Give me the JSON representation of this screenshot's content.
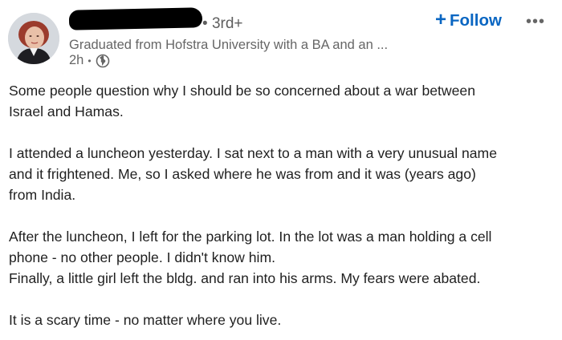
{
  "author": {
    "degree": "3rd+",
    "headline": "Graduated from Hofstra University with a BA and an ...",
    "time": "2h"
  },
  "follow": {
    "plus": "+",
    "label": "Follow"
  },
  "more_label": "•••",
  "post": {
    "paragraphs": [
      "Some people question why I should be so concerned about a war between\nIsrael and Hamas.",
      "I attended a luncheon yesterday. I sat next to a man with a very unusual name\nand it frightened. Me, so I asked where he was from and it was (years ago)\nfrom India.",
      "After the luncheon, I left for the parking lot. In the lot was a man holding a cell\nphone - no other people. I didn't know him.\nFinally, a little girl left the bldg. and ran into his arms. My fears were abated.",
      "It is a scary time - no matter where you live."
    ]
  },
  "icons": {
    "visibility": "globe-icon",
    "more": "more-dots-icon"
  },
  "colors": {
    "accent": "#0a66c2",
    "text": "#1f1f1f",
    "muted": "#666666",
    "redaction": "#000000"
  }
}
